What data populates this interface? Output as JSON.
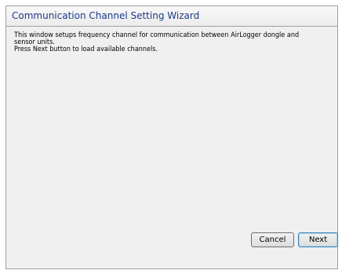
{
  "window": {
    "title": "Communication Channel Setting Wizard"
  },
  "message": {
    "line1": "This window setups frequency channel for communication between AirLogger dongle and",
    "line2": "sensor units.",
    "line3": "Press Next button to load available channels."
  },
  "buttons": {
    "cancel_label": "Cancel",
    "next_label": "Next"
  }
}
